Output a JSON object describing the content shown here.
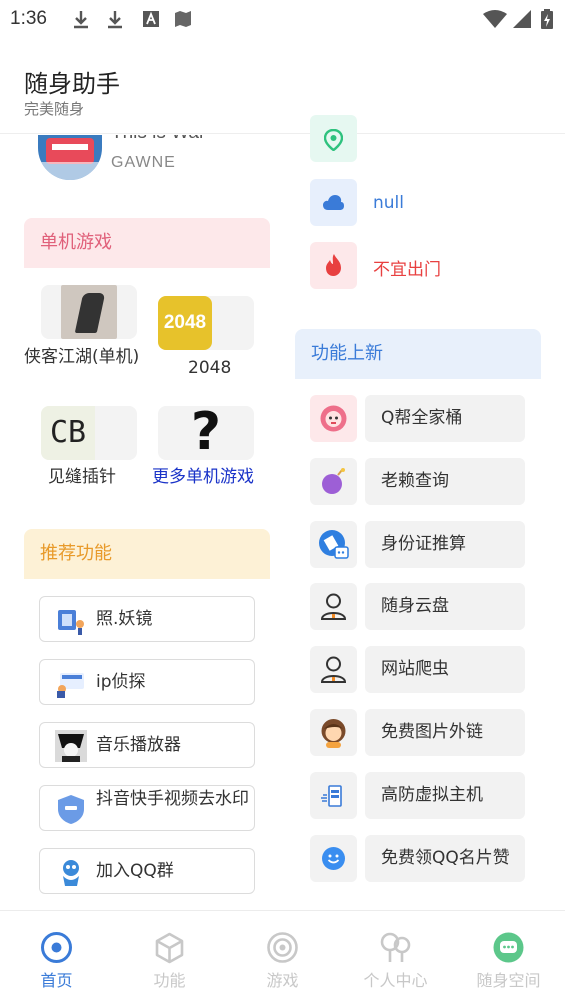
{
  "status_bar": {
    "time": "1:36"
  },
  "header": {
    "title": "随身助手",
    "subtitle": "完美随身"
  },
  "music": {
    "title": "This is War",
    "artist": "GAWNE"
  },
  "single_games": {
    "heading": "单机游戏",
    "items": [
      {
        "label": "侠客江湖(单机)"
      },
      {
        "label": "2048",
        "tile_text": "2048"
      },
      {
        "label": "见缝插针",
        "tile_text": "CB"
      },
      {
        "label": "更多单机游戏",
        "tile_text": "?"
      }
    ]
  },
  "recommended": {
    "heading": "推荐功能",
    "items": [
      {
        "label": "照.妖镜"
      },
      {
        "label": "ip侦探"
      },
      {
        "label": "音乐播放器"
      },
      {
        "label": "抖音快手视频去水印"
      },
      {
        "label": "加入QQ群"
      }
    ]
  },
  "info": {
    "items": [
      {
        "text": "",
        "icon": "location-icon"
      },
      {
        "text": "null",
        "icon": "cloud-icon"
      },
      {
        "text": "不宜出门",
        "icon": "fire-icon"
      }
    ]
  },
  "new_features": {
    "heading": "功能上新",
    "items": [
      {
        "label": "Q帮全家桶"
      },
      {
        "label": "老赖查询"
      },
      {
        "label": "身份证推算"
      },
      {
        "label": "随身云盘"
      },
      {
        "label": "网站爬虫"
      },
      {
        "label": "免费图片外链"
      },
      {
        "label": "高防虚拟主机"
      },
      {
        "label": "免费领QQ名片赞"
      }
    ]
  },
  "bottom_nav": {
    "items": [
      {
        "label": "首页"
      },
      {
        "label": "功能"
      },
      {
        "label": "游戏"
      },
      {
        "label": "个人中心"
      },
      {
        "label": "随身空间"
      }
    ]
  },
  "colors": {
    "accent": "#3a7bd8",
    "pink_text": "#e0607a",
    "yellow_text": "#e89a2a",
    "weather_red": "#e84040",
    "map_green": "#2ec27e"
  }
}
